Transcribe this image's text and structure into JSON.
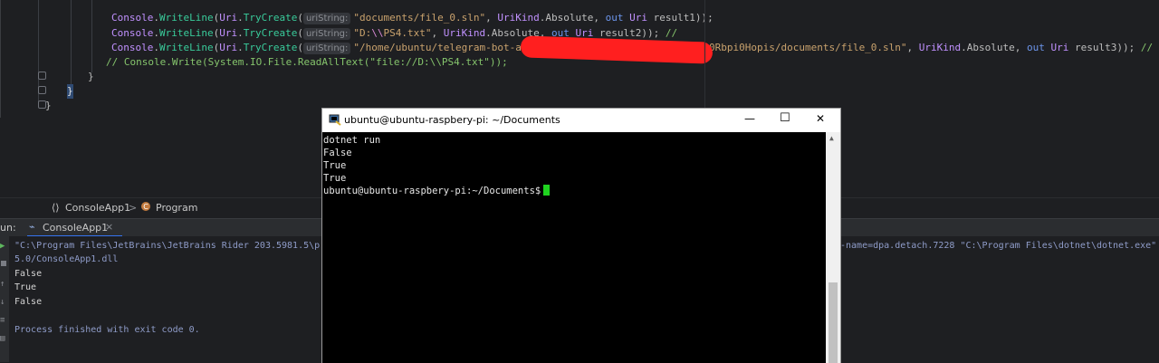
{
  "editor": {
    "lines": [
      {
        "id": "l1",
        "parts": [
          {
            "c": "cls",
            "t": "Console"
          },
          {
            "c": "",
            "t": "."
          },
          {
            "c": "mth",
            "t": "WriteLine"
          },
          {
            "c": "",
            "t": "("
          },
          {
            "c": "cls",
            "t": "Uri"
          },
          {
            "c": "",
            "t": "."
          },
          {
            "c": "mth",
            "t": "TryCreate"
          },
          {
            "c": "",
            "t": "("
          },
          {
            "c": "hint",
            "t": "uriString:"
          },
          {
            "c": "str",
            "t": "\"documents/file_0.sln\""
          },
          {
            "c": "",
            "t": ", "
          },
          {
            "c": "cls",
            "t": "UriKind"
          },
          {
            "c": "",
            "t": ".Absolute, "
          },
          {
            "c": "kw",
            "t": "out "
          },
          {
            "c": "cls",
            "t": "Uri"
          },
          {
            "c": "",
            "t": " result1));"
          }
        ]
      },
      {
        "id": "l2",
        "parts": [
          {
            "c": "cls",
            "t": "Console"
          },
          {
            "c": "",
            "t": "."
          },
          {
            "c": "mth",
            "t": "WriteLine"
          },
          {
            "c": "",
            "t": "("
          },
          {
            "c": "cls",
            "t": "Uri"
          },
          {
            "c": "",
            "t": "."
          },
          {
            "c": "mth",
            "t": "TryCreate"
          },
          {
            "c": "",
            "t": "("
          },
          {
            "c": "hint",
            "t": "uriString:"
          },
          {
            "c": "str",
            "t": "\"D:"
          },
          {
            "c": "esc",
            "t": "\\\\"
          },
          {
            "c": "str",
            "t": "PS4.txt\""
          },
          {
            "c": "",
            "t": ", "
          },
          {
            "c": "cls",
            "t": "UriKind"
          },
          {
            "c": "",
            "t": ".Absolute, "
          },
          {
            "c": "kw",
            "t": "out "
          },
          {
            "c": "cls",
            "t": "Uri"
          },
          {
            "c": "",
            "t": " result2)); "
          },
          {
            "c": "cmt",
            "t": "//"
          }
        ]
      },
      {
        "id": "l3a",
        "parts": [
          {
            "c": "cls",
            "t": "Console"
          },
          {
            "c": "",
            "t": "."
          },
          {
            "c": "mth",
            "t": "WriteLine"
          },
          {
            "c": "",
            "t": "("
          },
          {
            "c": "cls",
            "t": "Uri"
          },
          {
            "c": "",
            "t": "."
          },
          {
            "c": "mth",
            "t": "TryCreate"
          },
          {
            "c": "",
            "t": "("
          },
          {
            "c": "hint",
            "t": "uriString:"
          },
          {
            "c": "str",
            "t": "\"/home/ubuntu/telegram-bot-api/bin"
          }
        ]
      },
      {
        "id": "l3b",
        "parts": [
          {
            "c": "str",
            "t": "0Rbpi0Hopis/documents/file_0.sln\""
          },
          {
            "c": "",
            "t": ", "
          },
          {
            "c": "cls",
            "t": "UriKind"
          },
          {
            "c": "",
            "t": ".Absolute, "
          },
          {
            "c": "kw",
            "t": "out "
          },
          {
            "c": "cls",
            "t": "Uri"
          },
          {
            "c": "",
            "t": " result3)); "
          },
          {
            "c": "cmt",
            "t": "//"
          }
        ]
      },
      {
        "id": "l4",
        "parts": [
          {
            "c": "cmt",
            "t": "// Console.Write(System.IO.File.ReadAllText(\"file://D:\\\\PS4.txt\"));"
          }
        ]
      }
    ],
    "brace1": "}",
    "brace2": "}",
    "brace3": "}"
  },
  "breadcrumb": {
    "namespace_label": "ConsoleApp1",
    "separator": ">",
    "class_label": "Program"
  },
  "run_panel": {
    "label": "un:",
    "tab_label": "ConsoleApp1",
    "close_glyph": "×",
    "output": {
      "cmd_left": "\"C:\\Program Files\\JetBrains\\JetBrains Rider 203.5981.5\\p",
      "cmd_right": "-name=dpa.detach.7228 \"C:\\Program Files\\dotnet\\dotnet.exe\"",
      "dll_line": "5.0/ConsoleApp1.dll",
      "result1": "False",
      "result2": "True",
      "result3": "False",
      "exit_line": "Process finished with exit code 0."
    }
  },
  "terminal": {
    "title": "ubuntu@ubuntu-raspbery-pi: ~/Documents",
    "minimize_glyph": "—",
    "maximize_glyph": "☐",
    "close_glyph": "✕",
    "lines": [
      "dotnet run",
      "False",
      "True",
      "True"
    ],
    "prompt": "ubuntu@ubuntu-raspbery-pi:~/Documents$"
  },
  "colors": {
    "editor_bg": "#1e1f22",
    "redaction": "#ff1f1f",
    "terminal_cursor": "#1fd21f"
  }
}
